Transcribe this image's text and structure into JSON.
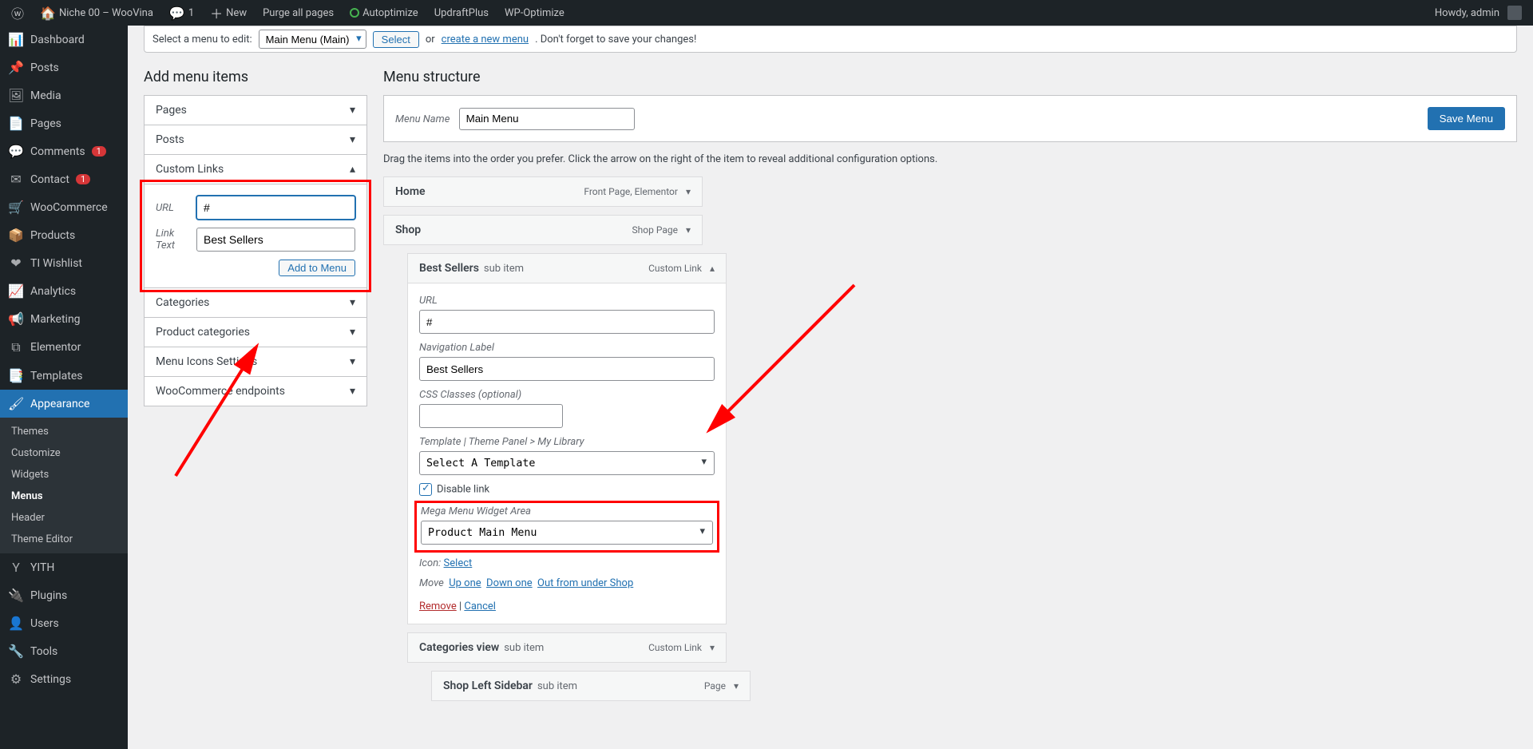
{
  "adminbar": {
    "site": "Niche 00 – WooVina",
    "comments": "1",
    "new": "New",
    "purge": "Purge all pages",
    "autoptimize": "Autoptimize",
    "updraft": "UpdraftPlus",
    "wpopt": "WP-Optimize",
    "howdy": "Howdy, admin"
  },
  "sidebar": {
    "items": [
      {
        "icon": "📊",
        "label": "Dashboard"
      },
      {
        "icon": "📌",
        "label": "Posts"
      },
      {
        "icon": "🖼",
        "label": "Media"
      },
      {
        "icon": "📄",
        "label": "Pages"
      },
      {
        "icon": "💬",
        "label": "Comments",
        "badge": "1"
      },
      {
        "icon": "✉",
        "label": "Contact",
        "badge": "1"
      },
      {
        "icon": "🛒",
        "label": "WooCommerce"
      },
      {
        "icon": "📦",
        "label": "Products"
      },
      {
        "icon": "❤",
        "label": "TI Wishlist"
      },
      {
        "icon": "📈",
        "label": "Analytics"
      },
      {
        "icon": "📢",
        "label": "Marketing"
      },
      {
        "icon": "⧉",
        "label": "Elementor"
      },
      {
        "icon": "📑",
        "label": "Templates"
      },
      {
        "icon": "🖌",
        "label": "Appearance",
        "current": true
      }
    ],
    "sub": [
      "Themes",
      "Customize",
      "Widgets",
      "Menus",
      "Header",
      "Theme Editor"
    ],
    "sub_active": "Menus",
    "items2": [
      {
        "icon": "Y",
        "label": "YITH"
      },
      {
        "icon": "🔌",
        "label": "Plugins"
      },
      {
        "icon": "👤",
        "label": "Users"
      },
      {
        "icon": "🔧",
        "label": "Tools"
      },
      {
        "icon": "⚙",
        "label": "Settings"
      }
    ]
  },
  "notice": {
    "select_label": "Select a menu to edit:",
    "selected": "Main Menu (Main)",
    "select_btn": "Select",
    "or": "or",
    "create_link": "create a new menu",
    "tail": ". Don't forget to save your changes!"
  },
  "left_heading": "Add menu items",
  "accordion": {
    "pages": "Pages",
    "posts": "Posts",
    "custom": "Custom Links",
    "url_label": "URL",
    "url_value": "#",
    "text_label": "Link Text",
    "text_value": "Best Sellers",
    "add_btn": "Add to Menu",
    "cats": "Categories",
    "prodcats": "Product categories",
    "menuicons": "Menu Icons Settings",
    "wcep": "WooCommerce endpoints"
  },
  "right_heading": "Menu structure",
  "menu_name_label": "Menu Name",
  "menu_name_value": "Main Menu",
  "save_btn": "Save Menu",
  "instructions": "Drag the items into the order you prefer. Click the arrow on the right of the item to reveal additional configuration options.",
  "items": {
    "home": {
      "title": "Home",
      "type": "Front Page, Elementor"
    },
    "shop": {
      "title": "Shop",
      "type": "Shop Page"
    },
    "best": {
      "title": "Best Sellers",
      "sub": "sub item",
      "type": "Custom Link",
      "url_label": "URL",
      "url_value": "#",
      "nav_label": "Navigation Label",
      "nav_value": "Best Sellers",
      "css_label": "CSS Classes (optional)",
      "css_value": "",
      "tpl_label": "Template",
      "tpl_hint": "| Theme Panel > My Library",
      "tpl_value": "Select A Template",
      "disable": "Disable link",
      "mega_label": "Mega Menu Widget Area",
      "mega_value": "Product Main Menu",
      "icon_label": "Icon:",
      "icon_select": "Select",
      "move": "Move",
      "up": "Up one",
      "down": "Down one",
      "out": "Out from under Shop",
      "remove": "Remove",
      "cancel": "Cancel"
    },
    "catview": {
      "title": "Categories view",
      "sub": "sub item",
      "type": "Custom Link"
    },
    "shopleft": {
      "title": "Shop Left Sidebar",
      "sub": "sub item",
      "type": "Page"
    }
  }
}
